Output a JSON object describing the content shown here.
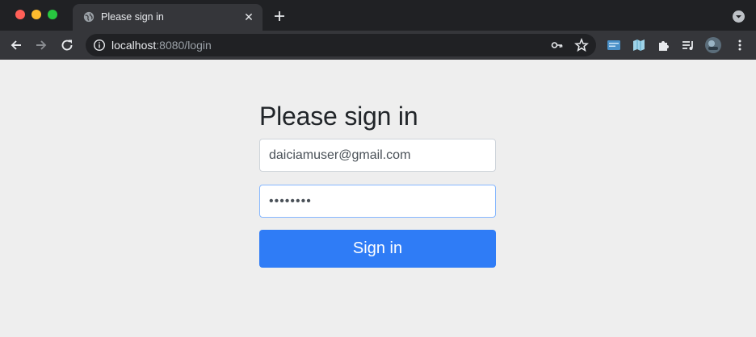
{
  "browser": {
    "tab": {
      "title": "Please sign in",
      "favicon": "globe-icon",
      "close_glyph": "✕"
    },
    "address": {
      "host": "localhost",
      "path": ":8080/login"
    }
  },
  "login": {
    "heading": "Please sign in",
    "username": {
      "value": "daiciamuser@gmail.com"
    },
    "password": {
      "value": "daiciamu"
    },
    "submit_label": "Sign in"
  },
  "colors": {
    "accent": "#2f7cf6",
    "page_bg": "#eeeeee",
    "chrome_dark": "#202124",
    "toolbar": "#35363a"
  }
}
